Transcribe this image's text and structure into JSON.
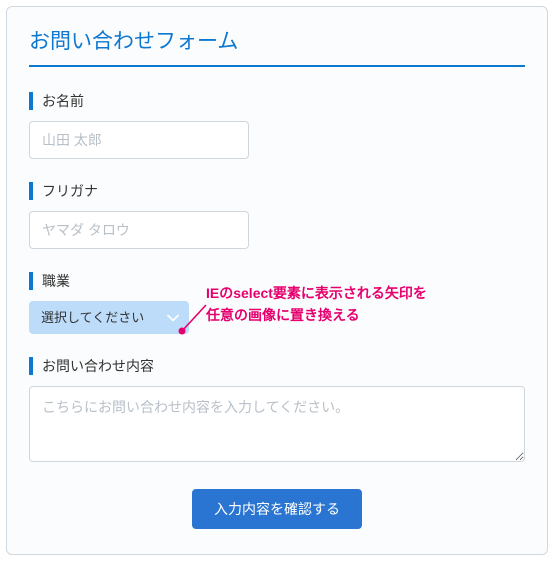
{
  "form": {
    "title": "お問い合わせフォーム",
    "fields": {
      "name": {
        "label": "お名前",
        "placeholder": "山田 太郎",
        "value": ""
      },
      "furigana": {
        "label": "フリガナ",
        "placeholder": "ヤマダ タロウ",
        "value": ""
      },
      "occupation": {
        "label": "職業",
        "selected": "選択してください"
      },
      "inquiry": {
        "label": "お問い合わせ内容",
        "placeholder": "こちらにお問い合わせ内容を入力してください。",
        "value": ""
      }
    },
    "submit_label": "入力内容を確認する"
  },
  "annotation": {
    "line1": "IEのselect要素に表示される矢印を",
    "line2": "任意の画像に置き換える"
  },
  "colors": {
    "accent": "#0d78d0",
    "select_bg": "#bcdcf9",
    "button_bg": "#2a75d1",
    "annotation": "#e6006e"
  }
}
